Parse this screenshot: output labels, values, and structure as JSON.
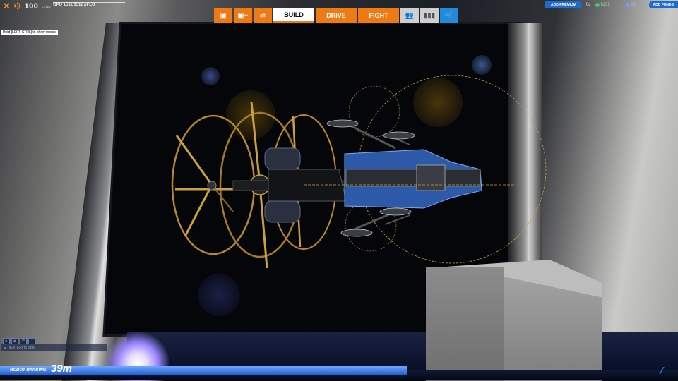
{
  "hud": {
    "level": "100",
    "level_label": "LEVEL",
    "gpu": "GPU 1511/1511 pFLO",
    "hint": "Hold [LEFT CTRL] to show mouse"
  },
  "tabs": [
    {
      "label": "BUILD",
      "active": true
    },
    {
      "label": "DRIVE",
      "active": false
    },
    {
      "label": "FIGHT",
      "active": false
    }
  ],
  "account": {
    "add_premium": "ADD PREMIUM",
    "premium_days": "0d",
    "robits": "9252",
    "cosmetic_credits": "23",
    "add_funds": "ADD FUNDS"
  },
  "chat": {
    "placeholder": "[ENTER] to type"
  },
  "ranking": {
    "label": "ROBOT RANKING:",
    "value": "39m",
    "progress": 0.6
  },
  "colors": {
    "accent": "#ee7a14",
    "premium_blue": "#1e6bd0",
    "robit_green": "#4ec27a"
  }
}
